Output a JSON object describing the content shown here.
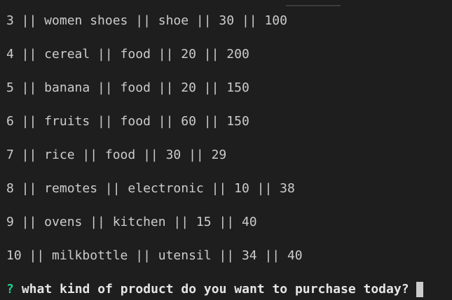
{
  "terminal": {
    "rows": [
      "3 || women shoes || shoe || 30 || 100",
      "4 || cereal || food || 20 || 200",
      "5 || banana || food || 20 || 150",
      "6 || fruits || food || 60 || 150",
      "7 || rice || food || 30 || 29",
      "8 || remotes || electronic || 10 || 38",
      "9 || ovens || kitchen || 15 || 40",
      "10 || milkbottle || utensil || 34 || 40"
    ],
    "prompt": {
      "mark": "?",
      "question": "what kind of product do you want to purchase today?"
    },
    "colors": {
      "background": "#1e1e1e",
      "text": "#cccccc",
      "prompt_mark": "#23d18b"
    }
  }
}
